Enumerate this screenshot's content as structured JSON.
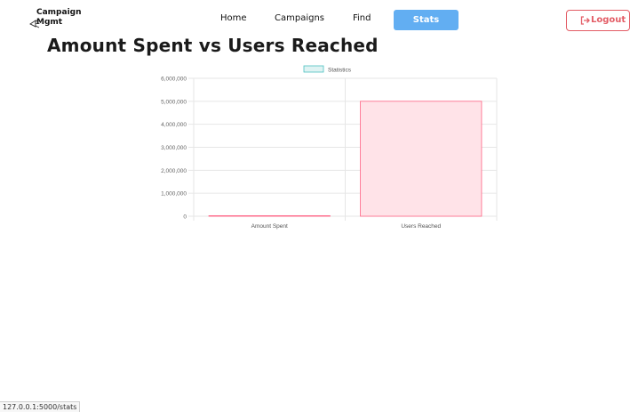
{
  "brand": {
    "line1": "Campaign",
    "line2": "Mgmt"
  },
  "nav": {
    "home": "Home",
    "campaigns": "Campaigns",
    "find": "Find",
    "stats": "Stats",
    "logout": "Logout"
  },
  "page": {
    "title": "Amount Spent vs Users Reached"
  },
  "chart_data": {
    "type": "bar",
    "categories": [
      "Amount Spent",
      "Users Reached"
    ],
    "series": [
      {
        "name": "Statistics",
        "values": [
          5000,
          5000000
        ]
      }
    ],
    "ylim": [
      0,
      6000000
    ],
    "yticks": [
      "0",
      "1,000,000",
      "2,000,000",
      "3,000,000",
      "4,000,000",
      "5,000,000",
      "6,000,000"
    ],
    "legend": "top-center",
    "grid": true,
    "colors": {
      "bar_fill": "#ffe3e8",
      "bar_stroke": "#ff6384",
      "legend_fill": "#dff3f3",
      "legend_stroke": "#4bc0c0",
      "grid": "#e6e6e6"
    }
  },
  "status_bar": {
    "url": "127.0.0.1:5000/stats"
  }
}
